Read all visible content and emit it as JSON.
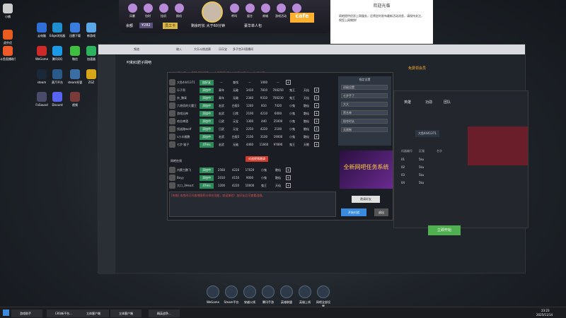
{
  "desktop_icons": [
    {
      "label": "虎扑优",
      "color": "#e85d1f"
    },
    {
      "label": "云电脑",
      "color": "#2f6fd6"
    },
    {
      "label": "Edge浏览器",
      "color": "#1e8fcf"
    },
    {
      "label": "迅雷下载",
      "color": "#3a7de0"
    },
    {
      "label": "新游戏",
      "color": "#5aa8e8"
    },
    {
      "label": "斗鱼直播助手",
      "color": "#f05a28"
    },
    {
      "label": "WeGame",
      "color": "#cf2a2a"
    },
    {
      "label": "腾讯QQ",
      "color": "#1a9be8"
    },
    {
      "label": "微信",
      "color": "#3fbf3f"
    },
    {
      "label": "加速器",
      "color": "#2db35d"
    },
    {
      "label": "steam",
      "color": "#1b2838"
    },
    {
      "label": "蒸汽平台",
      "color": "#2a5a8a"
    },
    {
      "label": "steam托管",
      "color": "#3b6ea5"
    },
    {
      "label": "ZGZ",
      "color": "#d6a818"
    },
    {
      "label": "FxSound",
      "color": "#4a4a6a"
    },
    {
      "label": "Discord",
      "color": "#5865f2"
    },
    {
      "label": "视频",
      "color": "#7a3a3a"
    }
  ],
  "topbar": {
    "items": [
      "风暴",
      "包时",
      "挂机",
      "换机",
      "呼叫",
      "留言",
      "商城",
      "游戏活动",
      "公告"
    ],
    "balance_label": "余额",
    "balance": "¥282",
    "member": "员工卡",
    "remaining": "剩余时长 大于60分钟",
    "table": "豪华单人包"
  },
  "notice": {
    "title": "欢迎光临",
    "text": "网吧提供优质上网服务，还将定时发布最新活动消息，请保持关注，祝您上网愉快!"
  },
  "client": {
    "title": "叼和红肥子网吧",
    "tabs": [
      "频道",
      "输入",
      "大乐斗挑战赛",
      "乐乐宝",
      "多子宫2d直播间"
    ],
    "notice": "电信光网专区->>FPS-万能双7+->金鲤国际VS人神(L3)江忍者>=七折半了",
    "button": "免费领会员"
  },
  "dialog": {
    "headers": [
      "",
      "资格",
      "",
      "1000",
      ""
    ],
    "rows": [
      {
        "name": "大鱼4441371",
        "tag": "加好友",
        "c1": "--",
        "c2": "查找",
        "c3": "--",
        "c4": "1000",
        "c5": "--"
      },
      {
        "name": "乐子哥",
        "tag": "添加中",
        "c1": "青年",
        "c2": "无敌",
        "c3": "3410",
        "c4": "7810",
        "c5": "700250",
        "c6": "鬼王",
        "c7": "天仙"
      },
      {
        "name": "杂_魏青",
        "tag": "添加中",
        "c1": "青年",
        "c2": "无敌",
        "c3": "2340",
        "c4": "9310",
        "c5": "700230",
        "c6": "鬼王",
        "c7": "天仙"
      },
      {
        "name": "六胡须的大魔王",
        "tag": "添加中",
        "c1": "宏武",
        "c2": "白银3",
        "c3": "1240",
        "c4": "810",
        "c5": "7420",
        "c6": "小鬼",
        "c7": "散仙"
      },
      {
        "name": "游戏出神",
        "tag": "添加中",
        "c1": "宏武",
        "c2": "日常",
        "c3": "2100",
        "c4": "4210",
        "c5": "6000",
        "c6": "小鬼",
        "c7": "散仙"
      },
      {
        "name": "哈苦啤酒",
        "tag": "添加中",
        "c1": "日武",
        "c2": "元宝",
        "c3": "1300",
        "c4": "440",
        "c5": "25000",
        "c6": "小鬼",
        "c7": "散仙"
      },
      {
        "name": "找迷路wolf",
        "tag": "添加中",
        "c1": "日武",
        "c2": "元宝",
        "c3": "2250",
        "c4": "4220",
        "c5": "2100",
        "c6": "小鬼",
        "c7": "散仙"
      },
      {
        "name": "v小丰雁鹏",
        "tag": "添加中",
        "c1": "宏武",
        "c2": "白银3",
        "c3": "2100",
        "c4": "3100",
        "c5": "19000",
        "c6": "小鬼",
        "c7": "散仙"
      },
      {
        "name": "七步·猴子",
        "tag": "47ms",
        "c1": "宏武",
        "c2": "无敌",
        "c3": "4460",
        "c4": "11660",
        "c5": "97890",
        "c6": "鬼王",
        "c7": "天眼"
      }
    ],
    "section2_title": "网吧在线",
    "section2_btn": "对战视频邀请",
    "rows2": [
      {
        "name": "内蒙古鹏飞",
        "tag": "添加中",
        "c1": "2560",
        "c2": "4220",
        "c3": "17020",
        "c4": "小鬼",
        "c5": "散仙"
      },
      {
        "name": "Boyy",
        "tag": "添加中",
        "c1": "2010",
        "c2": "4150",
        "c3": "9000",
        "c4": "小鬼",
        "c5": "散仙"
      },
      {
        "name": "大口_3Heart",
        "tag": "47ms",
        "c1": "1200",
        "c2": "4220",
        "c3": "10000",
        "c4": "鬼王",
        "c5": "天仙"
      }
    ],
    "chat_line": "[系统] 本房间已开放地图积分排名功能，欢迎体验！加好友后可查看战绩。",
    "panel_title": "指定设置",
    "panel_fields": [
      "初级设置",
      "七步手了",
      "大大",
      "黑名单",
      "抢夺时长",
      "无限制"
    ],
    "banner": "全新网吧任务系统",
    "btn_start": "开始对战",
    "btn_cancel": "退出",
    "btn_share": "邀请好友"
  },
  "game": {
    "tabs": [
      "英雄",
      "功勋",
      "团队"
    ],
    "user": "大鱼4441371",
    "list_headers": [
      "机器编号",
      "区服",
      "名字"
    ],
    "rows": [
      [
        "01",
        "5ku",
        ""
      ],
      [
        "02",
        "5ku",
        ""
      ],
      [
        "03",
        "5ku",
        ""
      ],
      [
        "04",
        "5ku",
        ""
      ]
    ],
    "start": "立即开始"
  },
  "dock": [
    "WeGame",
    "Steam平台",
    "穿越火线",
    "腾讯手游",
    "英雄联盟",
    "英雄上线",
    "网吧全部设置"
  ],
  "taskbar": {
    "items": [
      "游戏助手",
      "(36)新平台...",
      "立体客户端",
      "立体客户端",
      "精英战争..."
    ],
    "time": "23:23",
    "date": "2025/11/14"
  }
}
